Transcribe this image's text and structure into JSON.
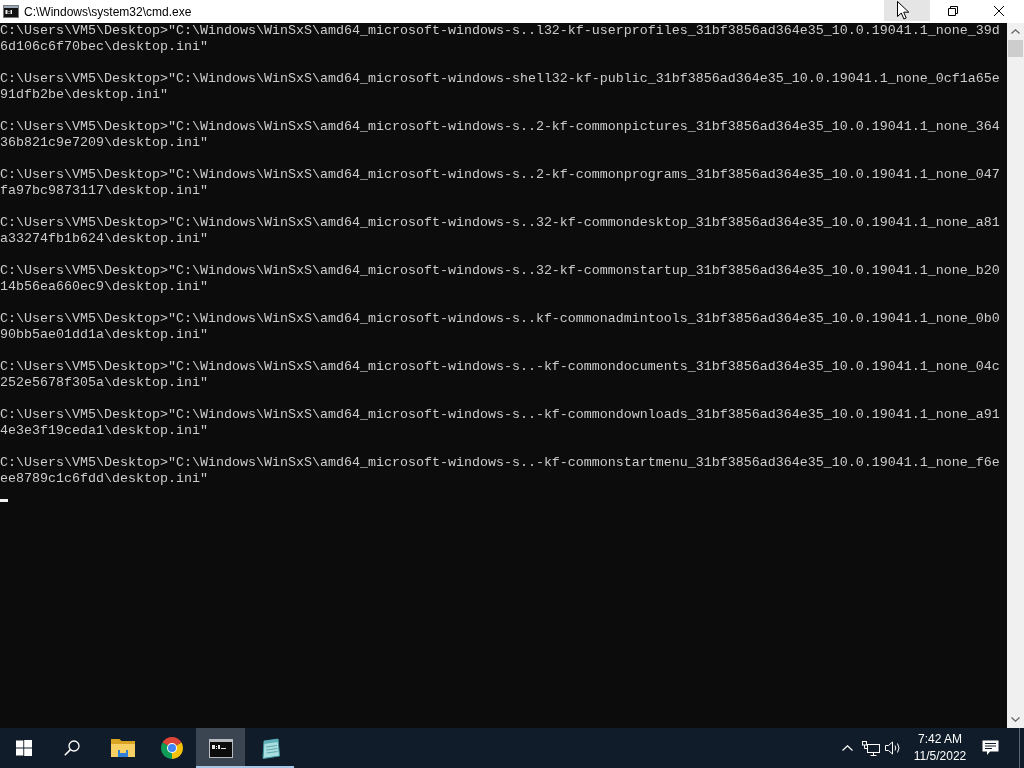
{
  "window": {
    "title": "C:\\Windows\\system32\\cmd.exe",
    "controls": [
      {
        "kind": "minimize",
        "hovered": true
      },
      {
        "kind": "restore",
        "hovered": false
      },
      {
        "kind": "close",
        "hovered": false
      }
    ]
  },
  "console": {
    "commands": [
      {
        "lines": [
          "C:\\Users\\VM5\\Desktop>\"C:\\Windows\\WinSxS\\amd64_microsoft-windows-s..l32-kf-userprofiles_31bf3856ad364e35_10.0.19041.1_none_39d",
          "6d106c6f70bec\\desktop.ini\""
        ]
      },
      {
        "lines": [
          "C:\\Users\\VM5\\Desktop>\"C:\\Windows\\WinSxS\\amd64_microsoft-windows-shell32-kf-public_31bf3856ad364e35_10.0.19041.1_none_0cf1a65e",
          "91dfb2be\\desktop.ini\""
        ]
      },
      {
        "lines": [
          "C:\\Users\\VM5\\Desktop>\"C:\\Windows\\WinSxS\\amd64_microsoft-windows-s..2-kf-commonpictures_31bf3856ad364e35_10.0.19041.1_none_364",
          "36b821c9e7209\\desktop.ini\""
        ]
      },
      {
        "lines": [
          "C:\\Users\\VM5\\Desktop>\"C:\\Windows\\WinSxS\\amd64_microsoft-windows-s..2-kf-commonprograms_31bf3856ad364e35_10.0.19041.1_none_047",
          "fa97bc9873117\\desktop.ini\""
        ]
      },
      {
        "lines": [
          "C:\\Users\\VM5\\Desktop>\"C:\\Windows\\WinSxS\\amd64_microsoft-windows-s..32-kf-commondesktop_31bf3856ad364e35_10.0.19041.1_none_a81",
          "a33274fb1b624\\desktop.ini\""
        ]
      },
      {
        "lines": [
          "C:\\Users\\VM5\\Desktop>\"C:\\Windows\\WinSxS\\amd64_microsoft-windows-s..32-kf-commonstartup_31bf3856ad364e35_10.0.19041.1_none_b20",
          "14b56ea660ec9\\desktop.ini\""
        ]
      },
      {
        "lines": [
          "C:\\Users\\VM5\\Desktop>\"C:\\Windows\\WinSxS\\amd64_microsoft-windows-s..kf-commonadmintools_31bf3856ad364e35_10.0.19041.1_none_0b0",
          "90bb5ae01dd1a\\desktop.ini\""
        ]
      },
      {
        "lines": [
          "C:\\Users\\VM5\\Desktop>\"C:\\Windows\\WinSxS\\amd64_microsoft-windows-s..-kf-commondocuments_31bf3856ad364e35_10.0.19041.1_none_04c",
          "252e5678f305a\\desktop.ini\""
        ]
      },
      {
        "lines": [
          "C:\\Users\\VM5\\Desktop>\"C:\\Windows\\WinSxS\\amd64_microsoft-windows-s..-kf-commondownloads_31bf3856ad364e35_10.0.19041.1_none_a91",
          "4e3e3f19ceda1\\desktop.ini\""
        ]
      },
      {
        "lines": [
          "C:\\Users\\VM5\\Desktop>\"C:\\Windows\\WinSxS\\amd64_microsoft-windows-s..-kf-commonstartmenu_31bf3856ad364e35_10.0.19041.1_none_f6e",
          "ee8789c1c6fdd\\desktop.ini\""
        ]
      }
    ],
    "cursor": true
  },
  "taskbar": {
    "apps": [
      {
        "kind": "folder",
        "running": false,
        "selected": false
      },
      {
        "kind": "browser",
        "running": false,
        "selected": false
      },
      {
        "kind": "terminal",
        "running": true,
        "selected": true
      },
      {
        "kind": "notepad",
        "running": true,
        "selected": false
      }
    ],
    "tray": {
      "time": "7:42 AM",
      "date": "11/5/2022"
    }
  }
}
